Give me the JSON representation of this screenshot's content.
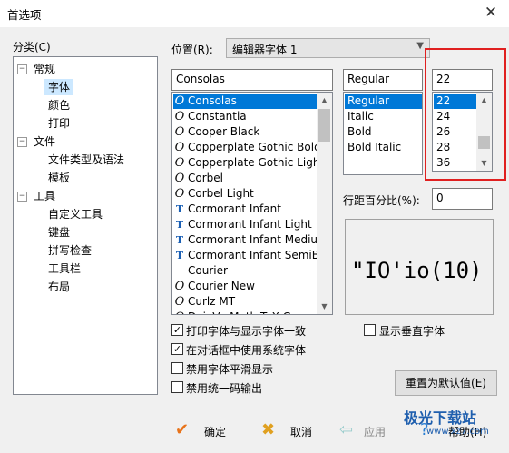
{
  "window": {
    "title": "首选项",
    "close_glyph": "✕"
  },
  "category": {
    "label": "分类(C)",
    "items": [
      {
        "label": "常规",
        "level": 0,
        "expanded": true
      },
      {
        "label": "字体",
        "level": 1,
        "selected": true
      },
      {
        "label": "颜色",
        "level": 1
      },
      {
        "label": "打印",
        "level": 1
      },
      {
        "label": "文件",
        "level": 0,
        "expanded": true
      },
      {
        "label": "文件类型及语法",
        "level": 1
      },
      {
        "label": "模板",
        "level": 1
      },
      {
        "label": "工具",
        "level": 0,
        "expanded": true
      },
      {
        "label": "自定义工具",
        "level": 1
      },
      {
        "label": "键盘",
        "level": 1
      },
      {
        "label": "拼写检查",
        "level": 1
      },
      {
        "label": "工具栏",
        "level": 1
      },
      {
        "label": "布局",
        "level": 1
      }
    ]
  },
  "location": {
    "label": "位置(R):",
    "value": "编辑器字体 1"
  },
  "font": {
    "name_value": "Consolas",
    "list": [
      {
        "name": "Consolas",
        "icon": "opentype-icon",
        "selected": true
      },
      {
        "name": "Constantia",
        "icon": "opentype-icon"
      },
      {
        "name": "Cooper Black",
        "icon": "opentype-icon"
      },
      {
        "name": "Copperplate Gothic Bold",
        "icon": "opentype-icon"
      },
      {
        "name": "Copperplate Gothic Light",
        "icon": "opentype-icon"
      },
      {
        "name": "Corbel",
        "icon": "opentype-icon"
      },
      {
        "name": "Corbel Light",
        "icon": "opentype-icon"
      },
      {
        "name": "Cormorant Infant",
        "icon": "truetype-icon"
      },
      {
        "name": "Cormorant Infant Light",
        "icon": "truetype-icon"
      },
      {
        "name": "Cormorant Infant Medium",
        "icon": "truetype-icon"
      },
      {
        "name": "Cormorant Infant SemiBold",
        "icon": "truetype-icon"
      },
      {
        "name": "Courier",
        "icon": ""
      },
      {
        "name": "Courier New",
        "icon": "opentype-icon"
      },
      {
        "name": "Curlz MT",
        "icon": "opentype-icon"
      },
      {
        "name": "DejaVu Math TeX Gyre",
        "icon": "opentype-icon"
      }
    ]
  },
  "style": {
    "value": "Regular",
    "list": [
      {
        "name": "Regular",
        "selected": true
      },
      {
        "name": "Italic"
      },
      {
        "name": "Bold"
      },
      {
        "name": "Bold Italic"
      }
    ]
  },
  "size": {
    "value": "22",
    "list": [
      {
        "name": "22",
        "selected": true
      },
      {
        "name": "24"
      },
      {
        "name": "26"
      },
      {
        "name": "28"
      },
      {
        "name": "36"
      }
    ]
  },
  "line_spacing": {
    "label": "行距百分比(%):",
    "value": "0"
  },
  "preview": {
    "text": "\"IO'io(10)"
  },
  "options": [
    {
      "label": "打印字体与显示字体一致",
      "checked": true
    },
    {
      "label": "在对话框中使用系统字体",
      "checked": true
    },
    {
      "label": "禁用字体平滑显示",
      "checked": false
    },
    {
      "label": "禁用统一码输出",
      "checked": false
    }
  ],
  "show_vertical": {
    "label": "显示垂直字体",
    "checked": false
  },
  "reset_button": "重置为默认值(E)",
  "footer": {
    "ok": "确定",
    "cancel": "取消",
    "apply": "应用",
    "help": "帮助(H)"
  },
  "watermark": {
    "brand": "极光下载站",
    "url": "www.xz7.com"
  },
  "colors": {
    "selection": "#0078d7",
    "highlight_box": "#e02020"
  }
}
